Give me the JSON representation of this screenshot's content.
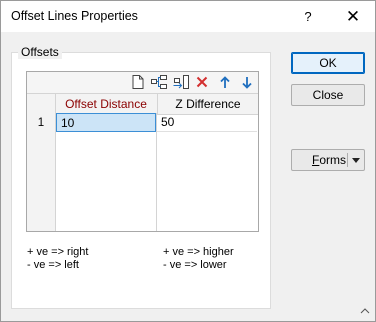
{
  "window": {
    "title": "Offset Lines Properties",
    "help_label": "?",
    "close_label": "✕"
  },
  "offsets_group": {
    "label": "Offsets",
    "toolbar": {
      "icons": [
        "new-document-icon",
        "insert-row-icon",
        "append-row-icon",
        "delete-icon",
        "move-up-icon",
        "move-down-icon"
      ],
      "delete_color": "#d32f2f",
      "arrow_color": "#1f6fbf"
    },
    "columns": [
      "Offset Distance",
      "Z Difference"
    ],
    "active_column_color": "#8b0000",
    "rows": [
      {
        "num": "1",
        "offset_distance": "10",
        "z_difference": "50"
      }
    ],
    "notes_left": [
      "+ ve => right",
      "- ve => left"
    ],
    "notes_right": [
      "+ ve => higher",
      "- ve => lower"
    ]
  },
  "buttons": {
    "ok": "OK",
    "close": "Close",
    "forms": "Forms",
    "forms_mnemonic": "F",
    "forms_rest": "orms"
  }
}
